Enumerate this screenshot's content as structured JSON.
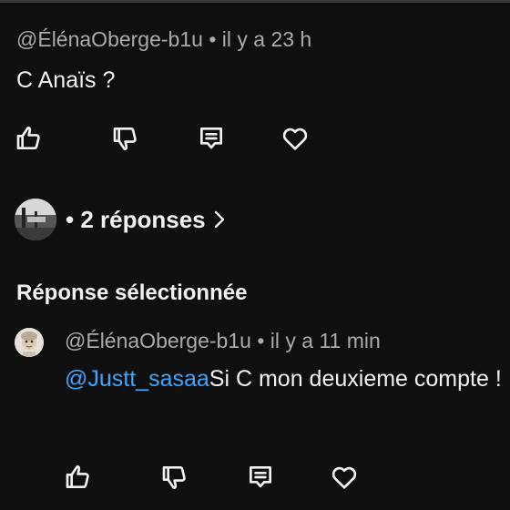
{
  "comment": {
    "author": "@ÉlénaOberge-b1u",
    "separator": "•",
    "time": "il y a 23 h",
    "text": "C Anaïs ?"
  },
  "replies": {
    "bullet": "•",
    "count_label": "2 réponses"
  },
  "section_title": "Réponse sélectionnée",
  "reply": {
    "author": "@ÉlénaOberge-b1u",
    "separator": "•",
    "time": "il y a 11 min",
    "mention": "@Justt_sasaa",
    "text": "Si C mon deuxieme compte !"
  },
  "actions": [
    "like-icon",
    "dislike-icon",
    "reply-icon",
    "heart-icon"
  ],
  "colors": {
    "background": "#0f0f0f",
    "text": "#f1f1f1",
    "meta": "#aaaaaa",
    "mention": "#3ea6ff"
  }
}
